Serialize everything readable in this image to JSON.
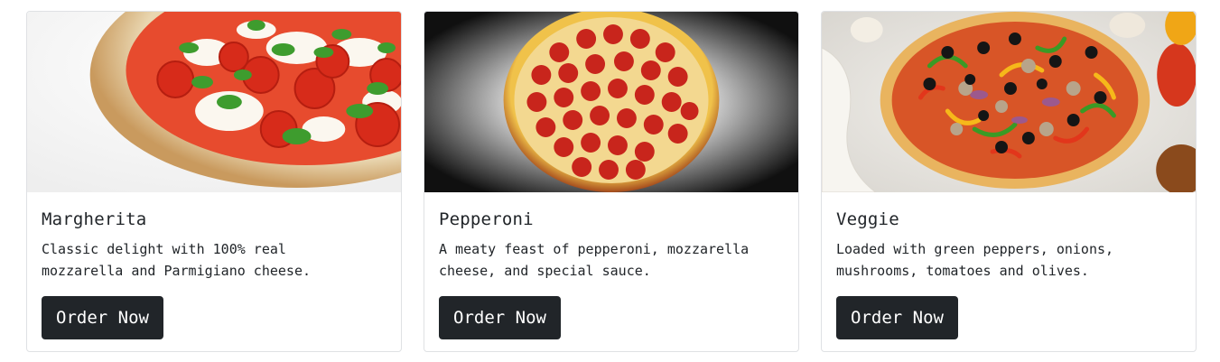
{
  "cards": [
    {
      "title": "Margherita",
      "description": "Classic delight with 100% real mozzarella and Parmigiano cheese.",
      "button": "Order Now",
      "image_icon": "margherita-pizza-image"
    },
    {
      "title": "Pepperoni",
      "description": "A meaty feast of pepperoni, mozzarella cheese, and special sauce.",
      "button": "Order Now",
      "image_icon": "pepperoni-pizza-image"
    },
    {
      "title": "Veggie",
      "description": "Loaded with green peppers, onions, mushrooms, tomatoes and olives.",
      "button": "Order Now",
      "image_icon": "veggie-pizza-image"
    }
  ],
  "colors": {
    "button_bg": "#212529",
    "button_text": "#ffffff",
    "text": "#212529",
    "card_border": "#dfe1e4"
  }
}
